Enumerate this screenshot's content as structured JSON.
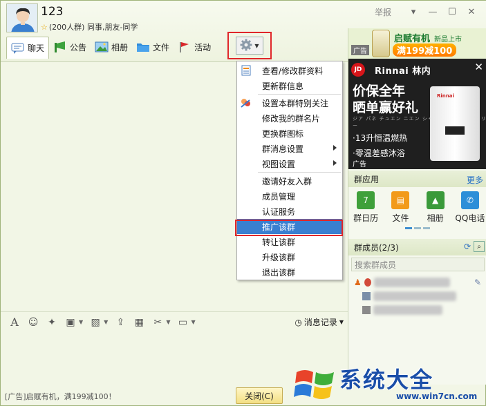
{
  "header": {
    "group_name": "123",
    "group_meta": "(200人群) 同事,朋友-同学",
    "report_label": "举报"
  },
  "toolbar": {
    "items": [
      {
        "label": "聊天"
      },
      {
        "label": "公告"
      },
      {
        "label": "相册"
      },
      {
        "label": "文件"
      },
      {
        "label": "活动"
      }
    ]
  },
  "menu": {
    "items": [
      "查看/修改群资料",
      "更新群信息",
      "设置本群特别关注",
      "修改我的群名片",
      "更换群图标",
      "群消息设置",
      "视图设置",
      "邀请好友入群",
      "成员管理",
      "认证服务",
      "推广该群",
      "转让该群",
      "升级该群",
      "退出该群"
    ]
  },
  "input_toolbar": {
    "msg_record": "消息记录"
  },
  "footer": {
    "ad_text": "[广告]启赋有机，满199减100！",
    "close_label": "关闭(C)"
  },
  "right": {
    "ad_top": {
      "line1": "启赋有机",
      "line1_small": "新品上市",
      "line2": "满199减100",
      "tag": "广告"
    },
    "ad_big": {
      "jd": "JD",
      "brand": "Rinnai 林内",
      "line1": "价保全年",
      "line2": "晒单赢好礼",
      "jp": "ジア パネ チュエン ニエン シャイ ダン イン ハオ リー",
      "feat1": "·13升恒温燃热",
      "feat2": "·零温差感沐浴",
      "tag": "广告",
      "heater_logo": "Rinnai"
    },
    "apps_title": "群应用",
    "apps_more": "更多",
    "apps": [
      {
        "label": "群日历",
        "glyph": "7"
      },
      {
        "label": "文件",
        "glyph": "▤"
      },
      {
        "label": "相册",
        "glyph": "▲"
      },
      {
        "label": "QQ电话",
        "glyph": "✆"
      }
    ],
    "members_title": "群成员(2/3)",
    "search_placeholder": "搜索群成员"
  },
  "watermark": {
    "title": "系统大全",
    "url": "www.win7cn.com"
  },
  "colors": {
    "highlight": "#3a7fd0",
    "annotation_red": "#e0262a",
    "link_blue": "#1f6cc7"
  }
}
